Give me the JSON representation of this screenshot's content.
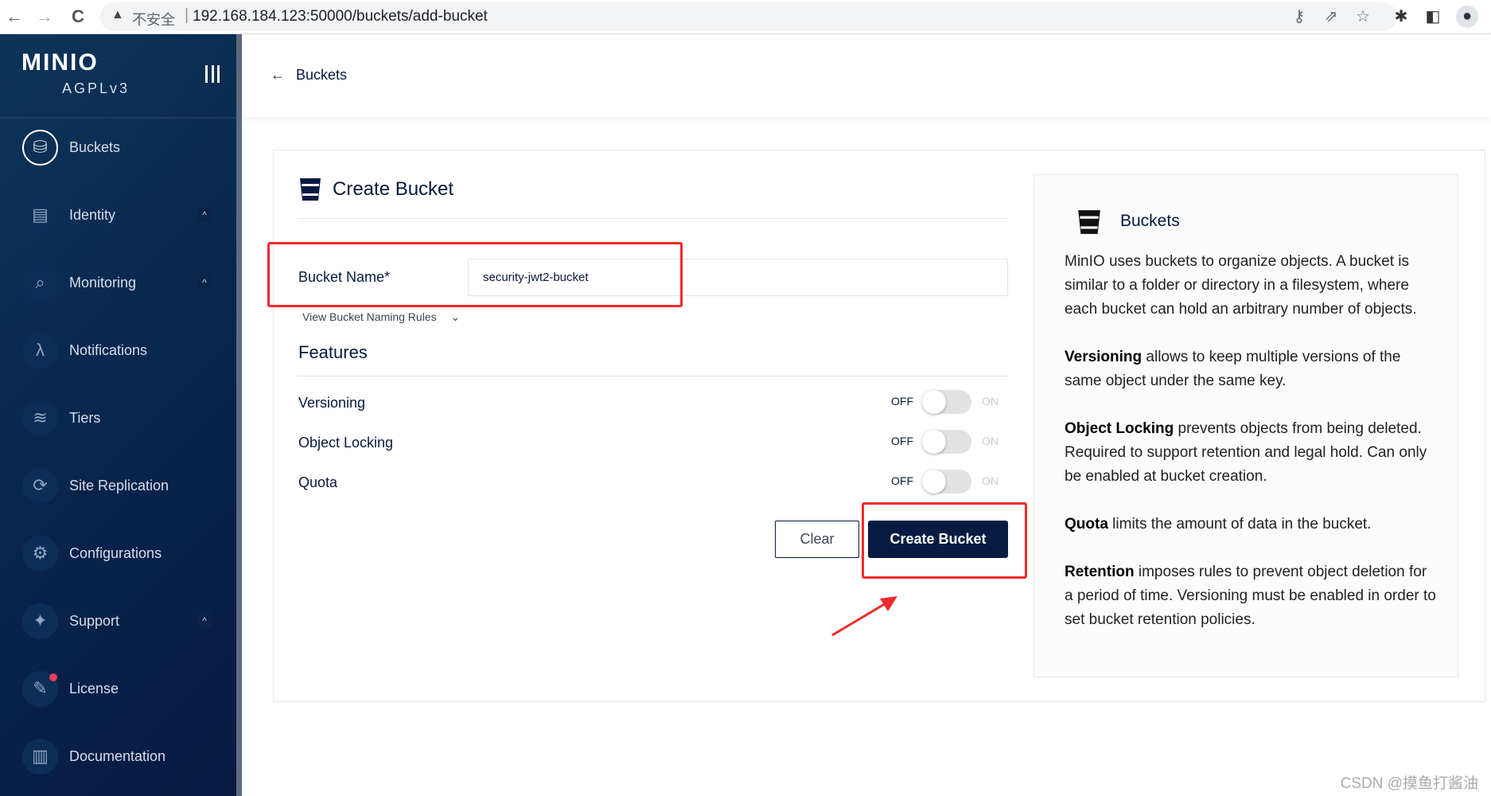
{
  "browser": {
    "back": "←",
    "forward": "→",
    "reload": "C",
    "insecure_label": "不安全",
    "url": "192.168.184.123:50000/buckets/add-bucket"
  },
  "sidebar": {
    "logo": "MINIO",
    "license_tag": "AGPLv3",
    "items": [
      {
        "label": "Buckets",
        "icon": "bucket-icon",
        "glyph": "⛁",
        "active": true
      },
      {
        "label": "Identity",
        "icon": "id-card-icon",
        "glyph": "▤",
        "caret": "^"
      },
      {
        "label": "Monitoring",
        "icon": "monitor-search-icon",
        "glyph": "⌕",
        "caret": "^"
      },
      {
        "label": "Notifications",
        "icon": "lambda-icon",
        "glyph": "λ"
      },
      {
        "label": "Tiers",
        "icon": "layers-icon",
        "glyph": "≋"
      },
      {
        "label": "Site Replication",
        "icon": "sync-icon",
        "glyph": "⟳"
      },
      {
        "label": "Configurations",
        "icon": "gear-icon",
        "glyph": "⚙"
      },
      {
        "label": "Support",
        "icon": "support-icon",
        "glyph": "✦",
        "caret": "^"
      },
      {
        "label": "License",
        "icon": "license-icon",
        "glyph": "✎"
      },
      {
        "label": "Documentation",
        "icon": "document-icon",
        "glyph": "▥"
      }
    ]
  },
  "header": {
    "back_arrow": "←",
    "breadcrumb": "Buckets"
  },
  "form": {
    "title": "Create Bucket",
    "bucket_name_label": "Bucket Name*",
    "bucket_name_value": "security-jwt2-bucket",
    "naming_rules": "View Bucket Naming Rules",
    "naming_rules_chevron": "⌄",
    "features_title": "Features",
    "features": [
      {
        "label": "Versioning",
        "off": "OFF",
        "on": "ON",
        "enabled": false
      },
      {
        "label": "Object Locking",
        "off": "OFF",
        "on": "ON",
        "enabled": false
      },
      {
        "label": "Quota",
        "off": "OFF",
        "on": "ON",
        "enabled": false
      }
    ],
    "clear_label": "Clear",
    "create_label": "Create Bucket"
  },
  "help": {
    "title": "Buckets",
    "intro": "MinIO uses buckets to organize objects. A bucket is similar to a folder or directory in a filesystem, where each bucket can hold an arbitrary number of objects.",
    "versioning_term": "Versioning",
    "versioning_text": " allows to keep multiple versions of the same object under the same key.",
    "locking_term": "Object Locking",
    "locking_text": " prevents objects from being deleted. Required to support retention and legal hold. Can only be enabled at bucket creation.",
    "quota_term": "Quota",
    "quota_text": " limits the amount of data in the bucket.",
    "retention_term": "Retention",
    "retention_text": " imposes rules to prevent object deletion for a period of time. Versioning must be enabled in order to set bucket retention policies."
  },
  "annotation_color": "#f02a2a",
  "watermark": "CSDN @摸鱼打酱油"
}
